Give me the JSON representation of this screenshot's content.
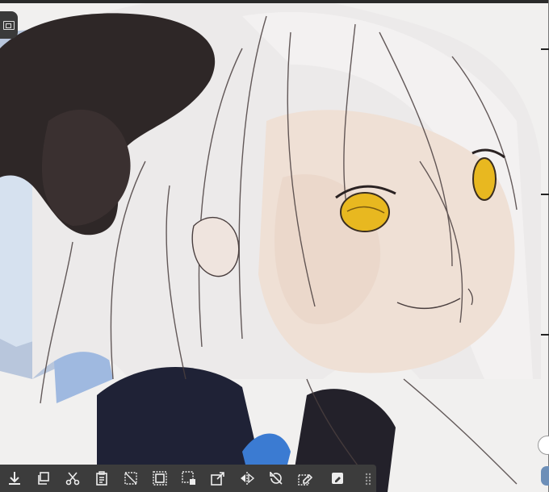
{
  "canvas": {
    "description_icon": "illustration-canvas"
  },
  "toolbar": {
    "buttons": [
      {
        "name": "download-icon"
      },
      {
        "name": "copy-icon"
      },
      {
        "name": "cut-icon"
      },
      {
        "name": "paste-icon"
      },
      {
        "name": "clear-icon"
      },
      {
        "name": "invert-selection-icon"
      },
      {
        "name": "select-layer-icon"
      },
      {
        "name": "transform-icon"
      },
      {
        "name": "flip-icon"
      },
      {
        "name": "rotate-off-icon"
      },
      {
        "name": "edit-selection-icon"
      },
      {
        "name": "quick-mask-icon"
      },
      {
        "name": "more-grid-icon"
      }
    ]
  },
  "colors": {
    "toolbar_bg": "#3c3c3c",
    "icon": "#ededed"
  }
}
